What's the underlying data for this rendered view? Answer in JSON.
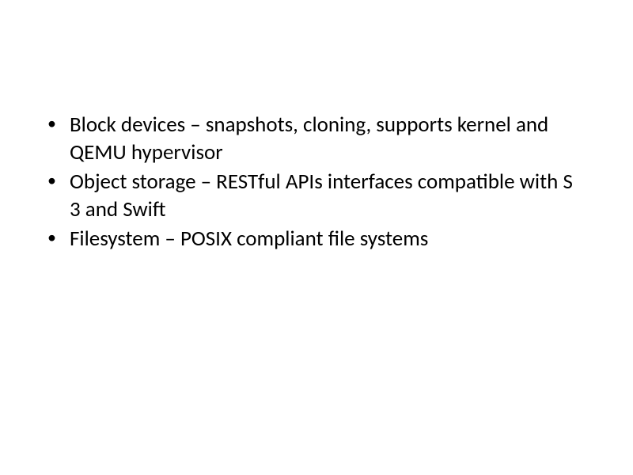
{
  "slide": {
    "bullets": [
      "Block devices – snapshots, cloning, supports kernel and QEMU hypervisor",
      "Object storage – RESTful APIs interfaces compatible with S 3 and Swift",
      "Filesystem – POSIX compliant file systems"
    ]
  }
}
